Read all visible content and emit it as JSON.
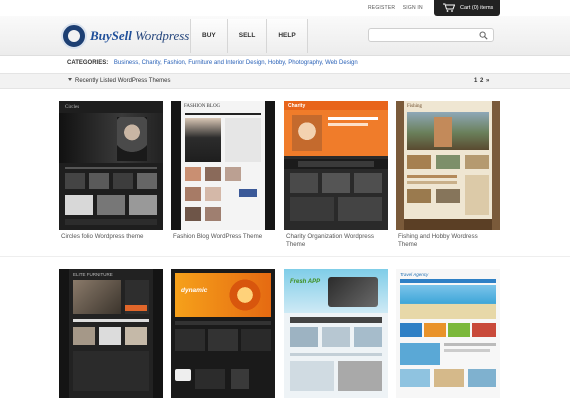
{
  "utility": {
    "register": "REGISTER",
    "sign_in": "SIGN IN",
    "cart": "Cart (0) items"
  },
  "header": {
    "logo_primary": "BuySell",
    "logo_secondary": "Wordpress",
    "nav": [
      "BUY",
      "SELL",
      "HELP"
    ],
    "search_placeholder": "",
    "search_value": ""
  },
  "categories": {
    "label": "CATEGORIES:",
    "items": [
      "Business",
      "Charity",
      "Fashion",
      "Furniture and Interior Design",
      "Hobby",
      "Photography",
      "Web Design"
    ]
  },
  "section": {
    "title": "Recently Listed WordPress Themes",
    "page_current": "1",
    "page_next": "2",
    "next_arrow": "»"
  },
  "themes": [
    {
      "caption": "Circles folio Wordpress theme",
      "thumb_title": "Circles"
    },
    {
      "caption": "Fashion Blog WordPress Theme",
      "thumb_title": "FASHION BLOG"
    },
    {
      "caption": "Charity Organization Wordpress Theme",
      "thumb_title": "Charity"
    },
    {
      "caption": "Fishing and Hobby Wordress Theme",
      "thumb_title": "Fishing"
    },
    {
      "caption": "",
      "thumb_title": "ELITE FURNITURE"
    },
    {
      "caption": "",
      "thumb_title": "dynamic"
    },
    {
      "caption": "",
      "thumb_title": "Fresh APP"
    },
    {
      "caption": "",
      "thumb_title": "Travel Agency"
    }
  ],
  "colors": {
    "link": "#2a62b8",
    "logo": "#1f4f9a",
    "cart_bg": "#222222"
  }
}
